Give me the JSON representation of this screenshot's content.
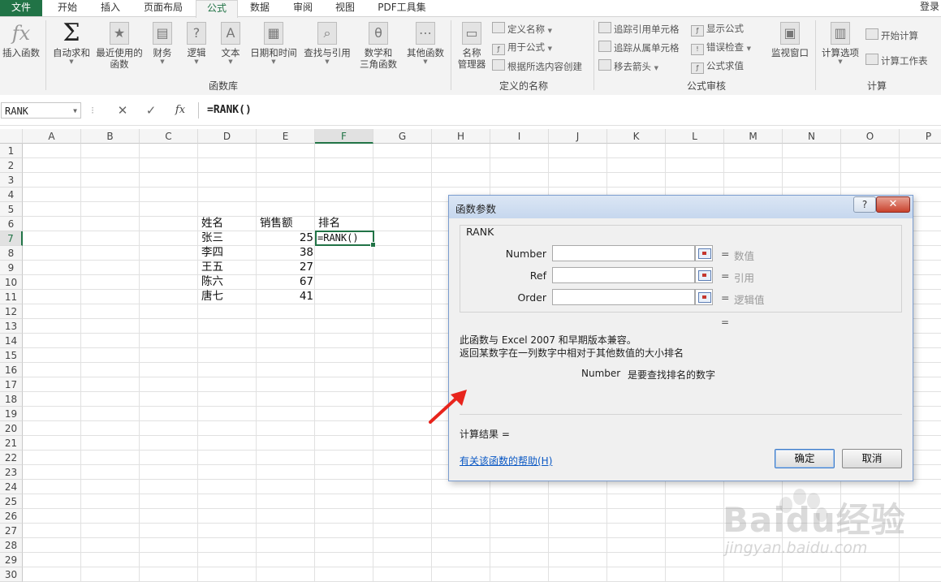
{
  "tabs": [
    "文件",
    "开始",
    "插入",
    "页面布局",
    "公式",
    "数据",
    "审阅",
    "视图",
    "PDF工具集"
  ],
  "active_tab": "公式",
  "login_label": "登录",
  "ribbon": {
    "insert_function": "插入函数",
    "autosum": "自动求和",
    "recent_1": "最近使用的",
    "recent_2": "函数",
    "financial": "财务",
    "logical": "逻辑",
    "text": "文本",
    "datetime": "日期和时间",
    "lookup": "查找与引用",
    "math_1": "数学和",
    "math_2": "三角函数",
    "more": "其他函数",
    "group_library": "函数库",
    "name_manager_1": "名称",
    "name_manager_2": "管理器",
    "define_name": "定义名称",
    "use_in_formula": "用于公式",
    "create_from_selection": "根据所选内容创建",
    "group_defined_names": "定义的名称",
    "trace_precedents": "追踪引用单元格",
    "trace_dependents": "追踪从属单元格",
    "remove_arrows": "移去箭头",
    "show_formulas": "显示公式",
    "error_checking": "错误检查",
    "evaluate_formula": "公式求值",
    "watch_window": "监视窗口",
    "group_auditing": "公式审核",
    "calc_options": "计算选项",
    "calc_now": "开始计算",
    "calc_sheet": "计算工作表",
    "group_calculation": "计算"
  },
  "formula_bar": {
    "name_box": "RANK",
    "cancel": "✕",
    "enter": "✓",
    "fx": "fx",
    "formula": "=RANK()"
  },
  "columns": [
    "A",
    "B",
    "C",
    "D",
    "E",
    "F",
    "G",
    "H",
    "I",
    "J",
    "K",
    "L",
    "M",
    "N",
    "O",
    "P"
  ],
  "selected_column": "F",
  "rows": [
    "1",
    "2",
    "3",
    "4",
    "5",
    "6",
    "7",
    "8",
    "9",
    "10",
    "11",
    "12",
    "13",
    "14",
    "15",
    "16",
    "17",
    "18",
    "19",
    "20",
    "21",
    "22",
    "23",
    "24",
    "25",
    "26",
    "27",
    "28",
    "29",
    "30"
  ],
  "selected_row": "7",
  "sheet": {
    "header_name": "姓名",
    "header_sales": "销售额",
    "header_rank": "排名",
    "records": [
      {
        "name": "张三",
        "sales": "25"
      },
      {
        "name": "李四",
        "sales": "38"
      },
      {
        "name": "王五",
        "sales": "27"
      },
      {
        "name": "陈六",
        "sales": "67"
      },
      {
        "name": "唐七",
        "sales": "41"
      }
    ],
    "active_formula": "=RANK()"
  },
  "dialog": {
    "title": "函数参数",
    "help_btn": "?",
    "close_btn": "✕",
    "function_name": "RANK",
    "args": [
      {
        "label": "Number",
        "value": "",
        "type_hint": "数值"
      },
      {
        "label": "Ref",
        "value": "",
        "type_hint": "引用"
      },
      {
        "label": "Order",
        "value": "",
        "type_hint": "逻辑值"
      }
    ],
    "equals": "=",
    "result_equals": "=",
    "compat_note": "此函数与 Excel 2007 和早期版本兼容。",
    "description": "返回某数字在一列数字中相对于其他数值的大小排名",
    "arg_help_name": "Number",
    "arg_help_text": "是要查找排名的数字",
    "calc_result_label": "计算结果 =",
    "help_link": "有关该函数的帮助(H)",
    "ok": "确定",
    "cancel": "取消"
  },
  "watermark": {
    "brand": "Baidu经验",
    "url": "jingyan.baidu.com"
  },
  "colors": {
    "excel_green": "#217346",
    "dialog_border": "#7a9ccf",
    "link_blue": "#0a58c4",
    "annotation_red": "#e8241c"
  }
}
